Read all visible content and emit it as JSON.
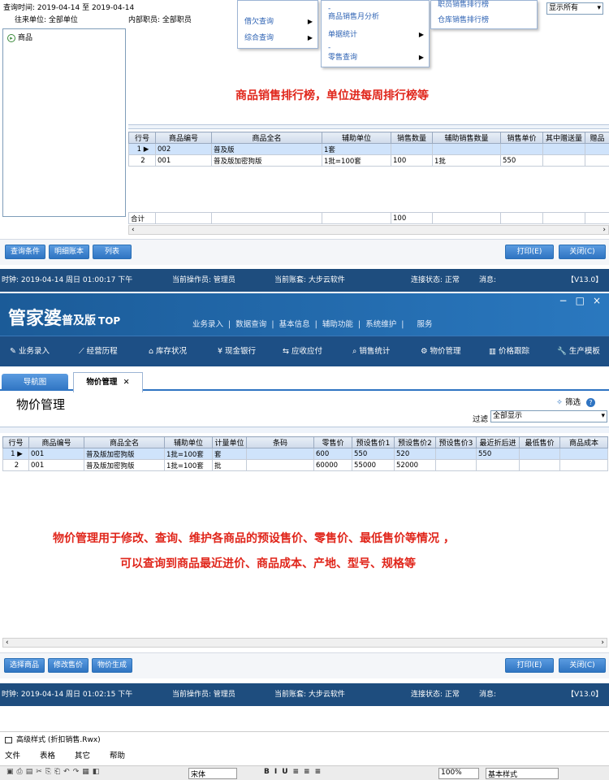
{
  "top": {
    "query_time_label": "查询时间:",
    "query_time_value": "2019-04-14 至 2019-04-14",
    "unit_label": "往来单位: 全部单位",
    "staff_label": "内部职员: 全部职员",
    "tree_root": "商品",
    "menu1": [
      "借欠查询",
      "综合查询"
    ],
    "menu2": [
      "-",
      "商品销售月分析",
      "单据统计",
      "-",
      "零售查询"
    ],
    "menu3": [
      "职员销售排行榜",
      "仓库销售排行榜"
    ],
    "display_select": "显示所有",
    "annotation": "商品销售排行榜，单位进每周排行榜等",
    "columns": [
      "行号",
      "商品编号",
      "商品全名",
      "辅助单位",
      "销售数量",
      "辅助销售数量",
      "销售单价",
      "其中赠送量",
      "赠品"
    ],
    "rows": [
      [
        "1",
        "002",
        "普及版",
        "1套",
        "",
        "",
        "",
        "",
        ""
      ],
      [
        "2",
        "001",
        "普及版加密狗版",
        "1批=100套",
        "100",
        "1批",
        "550",
        "",
        ""
      ]
    ],
    "total_label": "合计",
    "total_value": "100",
    "buttons": [
      "查询条件",
      "明细账本",
      "列表"
    ],
    "print": "打印(E)",
    "close": "关闭(C)"
  },
  "status1": {
    "time": "时钟: 2019-04-14 周日 01:00:17 下午",
    "op": "当前操作员: 管理员",
    "account": "当前账套: 大步云软件",
    "conn": "连接状态: 正常",
    "msg": "消息:",
    "ver": "【V13.0】"
  },
  "app": {
    "logo": "管家婆",
    "logo_sub": "普及版",
    "logo_top": "TOP",
    "nav": [
      "业务录入",
      "数据查询",
      "基本信息",
      "辅助功能",
      "系统维护",
      "服务"
    ],
    "window_controls": [
      "−",
      "□",
      "×"
    ],
    "toolbar": [
      "业务录入",
      "经营历程",
      "库存状况",
      "现金银行",
      "应收应付",
      "销售统计",
      "物价管理",
      "价格跟踪",
      "生产模板"
    ],
    "tabs": [
      "导航图",
      "物价管理"
    ],
    "title": "物价管理",
    "filter_btn": "筛选",
    "filter_label": "过滤",
    "filter_value": "全部显示",
    "columns": [
      "行号",
      "商品编号",
      "商品全名",
      "辅助单位",
      "计量单位",
      "条码",
      "零售价",
      "预设售价1",
      "预设售价2",
      "预设售价3",
      "最近折后进",
      "最低售价",
      "商品成本"
    ],
    "rows": [
      [
        "1",
        "001",
        "普及版加密狗版",
        "1批=100套",
        "套",
        "",
        "600",
        "550",
        "520",
        "",
        "550",
        "",
        ""
      ],
      [
        "2",
        "001",
        "普及版加密狗版",
        "1批=100套",
        "批",
        "",
        "60000",
        "55000",
        "52000",
        "",
        "",
        "",
        ""
      ]
    ],
    "annotation1": "物价管理用于修改、查询、维护各商品的预设售价、零售价、最低售价等情况 ，",
    "annotation2": "可以查询到商品最近进价、商品成本、产地、型号、规格等",
    "buttons": [
      "选择商品",
      "修改售价",
      "物价生成"
    ],
    "print": "打印(E)",
    "close": "关闭(C)"
  },
  "status2": {
    "time": "时钟: 2019-04-14 周日 01:02:15 下午",
    "op": "当前操作员: 管理员",
    "account": "当前账套: 大步云软件",
    "conn": "连接状态: 正常",
    "msg": "消息:",
    "ver": "【V13.0】"
  },
  "bottom": {
    "title": "高级样式 (折扣销售.Rwx)",
    "menu": [
      "文件",
      "表格",
      "其它",
      "帮助"
    ],
    "font": "宋体",
    "zoom": "100%",
    "style": "基本样式"
  },
  "colors": {
    "accent": "#2f74c2",
    "status": "#1e4d7e",
    "header": "#1a5a96",
    "annotation": "#e0261b"
  }
}
